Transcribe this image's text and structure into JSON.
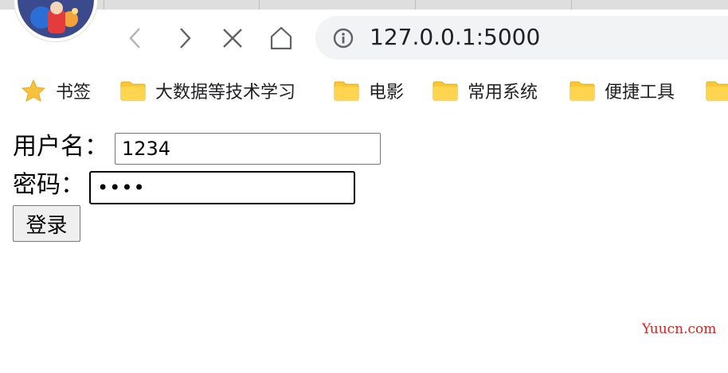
{
  "browser": {
    "url": "127.0.0.1:5000",
    "nav_icons": [
      "back-icon",
      "forward-icon",
      "stop-icon",
      "home-icon"
    ],
    "accent_folder": "#ffc107",
    "accent_star": "#f9a825"
  },
  "bookmarks": [
    {
      "label": "书签",
      "icon": "star-icon"
    },
    {
      "label": "大数据等技术学习",
      "icon": "folder-icon"
    },
    {
      "label": "电影",
      "icon": "folder-icon"
    },
    {
      "label": "常用系统",
      "icon": "folder-icon"
    },
    {
      "label": "便捷工具",
      "icon": "folder-icon"
    }
  ],
  "form": {
    "username_label": "用户名：",
    "username_value": "1234",
    "password_label": "密码：",
    "password_value": "••••",
    "submit_label": "登录"
  },
  "watermark": "Yuucn.com"
}
